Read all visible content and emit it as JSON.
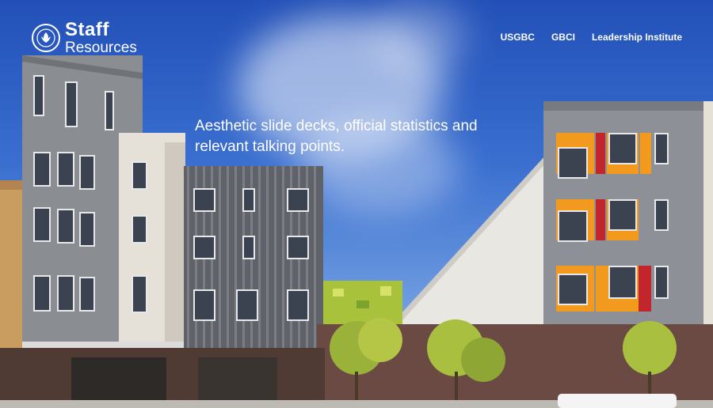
{
  "brand": {
    "title": "Staff",
    "subtitle": "Resources",
    "seal_icon": "usgbc-seal-icon"
  },
  "nav": {
    "items": [
      {
        "label": "USGBC"
      },
      {
        "label": "GBCI"
      },
      {
        "label": "Leadership Institute"
      }
    ]
  },
  "hero": {
    "tagline": "Aesthetic slide decks, official statistics and relevant talking points."
  },
  "colors": {
    "sky_top": "#2250b8",
    "sky_bottom": "#9cbbe6",
    "facade_grey": "#8a8d92",
    "facade_cream": "#e6e1d8",
    "accent_orange": "#f29a1e",
    "accent_red": "#c2262c",
    "brick": "#6b4a43"
  }
}
